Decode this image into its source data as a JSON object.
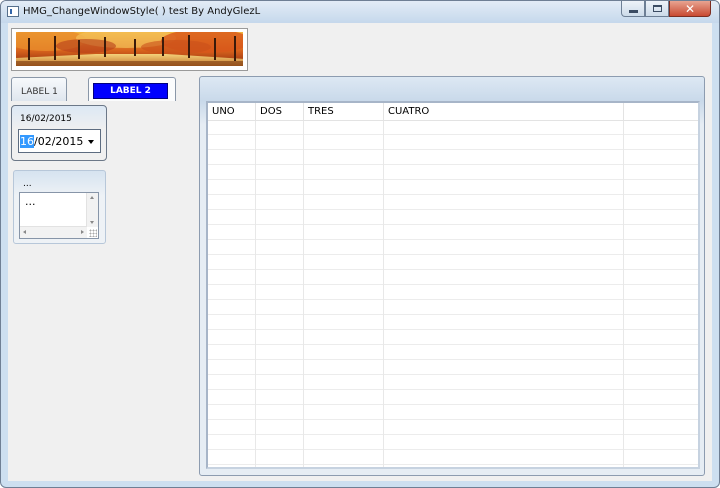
{
  "window": {
    "title": "HMG_ChangeWindowStyle( ) test By AndyGlezL",
    "close_glyph": "✕"
  },
  "tabs": [
    {
      "label": "LABEL 1"
    },
    {
      "label": "LABEL 2"
    }
  ],
  "date_panel": {
    "label": "16/02/2015",
    "value_selected": "16",
    "value_rest": "/02/2015"
  },
  "edit_panel": {
    "label": "...",
    "text": "..."
  },
  "grid": {
    "columns": [
      "UNO",
      "DOS",
      "TRES",
      "CUATRO"
    ]
  },
  "icons": {
    "app": "window-app-icon",
    "dropdown": "chevron-down-icon"
  }
}
